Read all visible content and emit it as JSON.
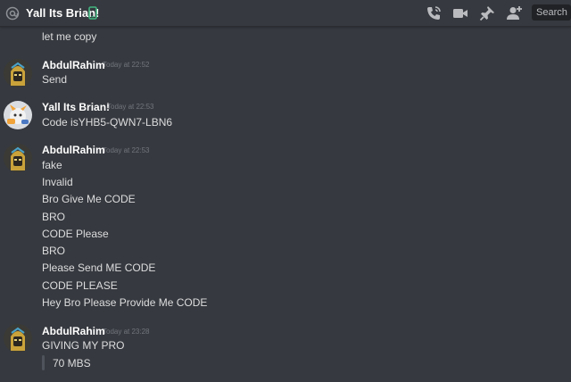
{
  "header": {
    "channel_name": "Yall Its Brian!",
    "search_placeholder": "Search",
    "at_icon": "at-icon",
    "status_icon": "mobile-phone-icon",
    "icons": [
      "phone-call-icon",
      "video-call-icon",
      "pin-icon",
      "add-friend-icon"
    ],
    "status_color": "#43b581"
  },
  "messages": {
    "m0": {
      "lines": [
        "let me copy"
      ]
    },
    "m1": {
      "author": "AbdulRahim",
      "timestamp": "Today at 22:52",
      "lines": [
        "Send"
      ]
    },
    "m2": {
      "author": "Yall Its Brian!",
      "timestamp": "Today at 22:53",
      "lines": [
        "Code isYHB5-QWN7-LBN6"
      ]
    },
    "m3": {
      "author": "AbdulRahim",
      "timestamp": "Today at 22:53",
      "lines": [
        "fake",
        "Invalid",
        "Bro Give Me CODE",
        "BRO",
        "CODE Please",
        "BRO",
        "Please Send ME CODE",
        "CODE PLEASE",
        "Hey Bro Please Provide Me CODE"
      ]
    },
    "m4": {
      "author": "AbdulRahim",
      "timestamp": "Today at 23:28",
      "lines": [
        "GIVING MY PRO"
      ],
      "quote": "70 MBS"
    }
  },
  "colors": {
    "background": "#36393f",
    "author": "#ffffff",
    "text": "#dcddde",
    "timestamp": "#72767d"
  }
}
